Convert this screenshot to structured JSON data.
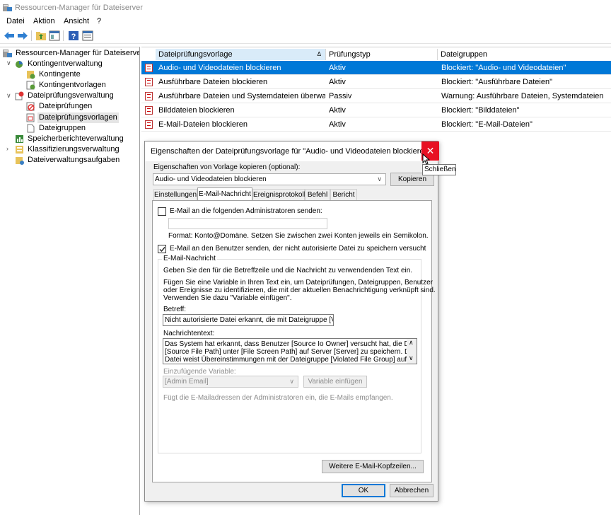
{
  "window": {
    "title": "Ressourcen-Manager für Dateiserver"
  },
  "menu": [
    "Datei",
    "Aktion",
    "Ansicht",
    "?"
  ],
  "tree": {
    "root": "Ressourcen-Manager für Dateiserver (l",
    "items": [
      {
        "label": "Kontingentverwaltung",
        "children": [
          "Kontingente",
          "Kontingentvorlagen"
        ]
      },
      {
        "label": "Dateiprüfungsverwaltung",
        "children": [
          "Dateiprüfungen",
          "Dateiprüfungsvorlagen",
          "Dateigruppen"
        ]
      },
      {
        "label": "Speicherberichteverwaltung"
      },
      {
        "label": "Klassifizierungsverwaltung"
      },
      {
        "label": "Dateiverwaltungsaufgaben"
      }
    ]
  },
  "list": {
    "columns": [
      "Dateiprüfungsvorlage",
      "Prüfungstyp",
      "Dateigruppen"
    ],
    "rows": [
      {
        "name": "Audio- und Videodateien blockieren",
        "type": "Aktiv",
        "groups": "Blockiert: \"Audio- und Videodateien\""
      },
      {
        "name": "Ausführbare Dateien blockieren",
        "type": "Aktiv",
        "groups": "Blockiert: \"Ausführbare Dateien\""
      },
      {
        "name": "Ausführbare Dateien und Systemdateien überwac...",
        "type": "Passiv",
        "groups": "Warnung: Ausführbare Dateien, Systemdateien"
      },
      {
        "name": "Bilddateien blockieren",
        "type": "Aktiv",
        "groups": "Blockiert: \"Bilddateien\""
      },
      {
        "name": "E-Mail-Dateien blockieren",
        "type": "Aktiv",
        "groups": "Blockiert: \"E-Mail-Dateien\""
      }
    ]
  },
  "dialog": {
    "title": "Eigenschaften der Dateiprüfungsvorlage für \"Audio- und Videodateien blockieren\"",
    "close_tooltip": "Schließen",
    "copy_label": "Eigenschaften von Vorlage kopieren (optional):",
    "copy_value": "Audio- und Videodateien blockieren",
    "copy_button": "Kopieren",
    "tabs": [
      "Einstellungen",
      "E-Mail-Nachricht",
      "Ereignisprotokoll",
      "Befehl",
      "Bericht"
    ],
    "admin_check": "E-Mail an die folgenden Administratoren senden:",
    "admin_format": "Format: Konto@Domäne. Setzen Sie zwischen zwei Konten jeweils ein Semikolon.",
    "user_check": "E-Mail an den Benutzer senden, der nicht autorisierte Datei zu speichern versucht",
    "group_title": "E-Mail-Nachricht",
    "intro": "Geben Sie den für die Betreffzeile und die Nachricht zu verwendenden Text ein.",
    "var_hint_1": "Fügen Sie eine Variable in Ihren Text ein, um Dateiprüfungen, Dateigruppen, Benutzer",
    "var_hint_2": "oder Ereignisse zu identifizieren, die mit der aktuellen Benachrichtigung verknüpft sind.",
    "var_hint_3": "Verwenden Sie dazu \"Variable einfügen\".",
    "subject_label": "Betreff:",
    "subject_value": "Nicht autorisierte Datei erkannt, die mit Dateigruppe [Violated",
    "body_label": "Nachrichtentext:",
    "body_1": "Das System hat erkannt, dass Benutzer [Source Io Owner] versucht hat, die Datei",
    "body_2": "[Source File Path] unter [File Screen Path] auf Server [Server] zu speichern. Diese",
    "body_3": "Datei weist Übereinstimmungen mit der Dateigruppe [Violated File Group] auf, die auf",
    "var_label": "Einzufügende Variable:",
    "var_value": "[Admin Email]",
    "var_button": "Variable einfügen",
    "var_desc": "Fügt die E-Mailadressen der Administratoren ein, die E-Mails empfangen.",
    "more_button": "Weitere E-Mail-Kopfzeilen...",
    "ok": "OK",
    "cancel": "Abbrechen"
  }
}
